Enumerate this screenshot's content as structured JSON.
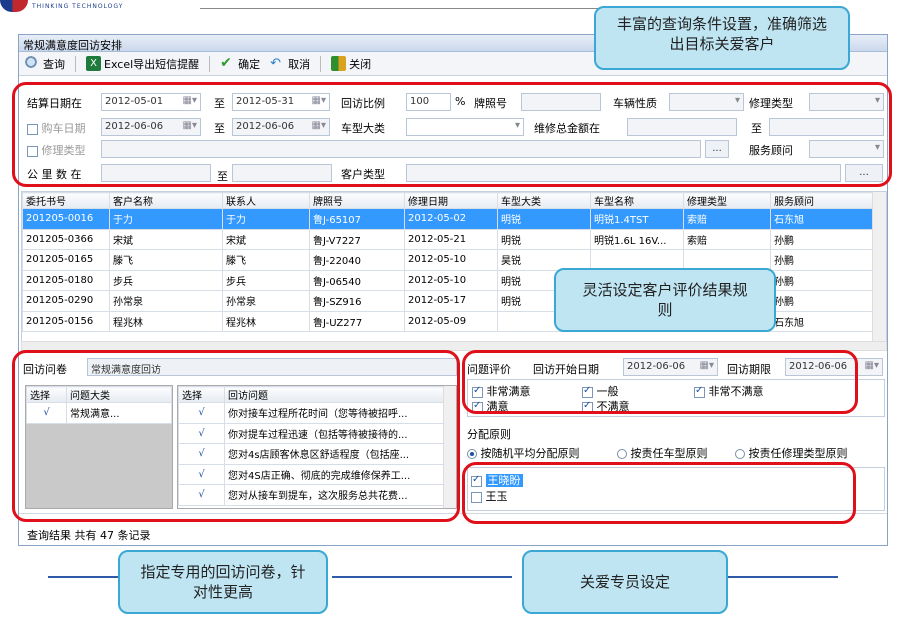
{
  "window": {
    "title": "常规满意度回访安排"
  },
  "toolbar": [
    {
      "label": "查询",
      "icon": "search-icon"
    },
    {
      "label": "Excel导出短信提醒",
      "icon": "excel-icon"
    },
    {
      "label": "确定",
      "icon": "check-icon"
    },
    {
      "label": "取消",
      "icon": "cancel-icon"
    },
    {
      "label": "关闭",
      "icon": "close-door-icon"
    }
  ],
  "filters": {
    "settle_date_label": "结算日期在",
    "settle_from": "2012-05-01",
    "to_label": "至",
    "settle_to": "2012-05-31",
    "visit_ratio_label": "回访比例",
    "visit_ratio": "100",
    "percent": "%",
    "plate_label": "牌照号",
    "vehicle_nature_label": "车辆性质",
    "repair_type_label": "修理类型",
    "purchase_date_label": "购车日期",
    "purchase_from": "2012-06-06",
    "purchase_to": "2012-06-06",
    "model_category_label": "车型大类",
    "repair_amount_label": "维修总金额在",
    "amount_to_label": "至",
    "repair_type2_label": "修理类型",
    "service_advisor_label": "服务顾问",
    "mileage_label": "公 里 数 在",
    "mileage_to_label": "至",
    "customer_type_label": "客户类型",
    "ellipsis": "..."
  },
  "table": {
    "columns": [
      "委托书号",
      "客户名称",
      "联系人",
      "牌照号",
      "修理日期",
      "车型大类",
      "车型名称",
      "修理类型",
      "服务顾问"
    ],
    "rows": [
      [
        "201205-0016",
        "于力",
        "于力",
        "鲁J-65107",
        "2012-05-02",
        "明锐",
        "明锐1.4TST",
        "索赔",
        "石东旭"
      ],
      [
        "201205-0366",
        "宋斌",
        "宋斌",
        "鲁J-V7227",
        "2012-05-21",
        "明锐",
        "明锐1.6L 16V...",
        "索赔",
        "孙鹏"
      ],
      [
        "201205-0165",
        "滕飞",
        "滕飞",
        "鲁J-22040",
        "2012-05-10",
        "昊锐",
        "",
        "",
        "孙鹏"
      ],
      [
        "201205-0180",
        "步兵",
        "步兵",
        "鲁J-06540",
        "2012-05-10",
        "明锐",
        "",
        "",
        "孙鹏"
      ],
      [
        "201205-0290",
        "孙常泉",
        "孙常泉",
        "鲁J-SZ916",
        "2012-05-17",
        "明锐",
        "",
        "",
        "孙鹏"
      ],
      [
        "201205-0156",
        "程兆林",
        "程兆林",
        "鲁J-UZ277",
        "2012-05-09",
        "",
        "",
        "",
        "石东旭"
      ]
    ]
  },
  "questionnaire": {
    "label": "回访问卷",
    "selected": "常规满意度回访",
    "left_columns": [
      "选择",
      "问题大类"
    ],
    "left_rows": [
      [
        "√",
        "常规满意..."
      ]
    ],
    "right_columns": [
      "选择",
      "回访问题"
    ],
    "right_rows": [
      [
        "√",
        "你对接车过程所花时间（您等待被招呼..."
      ],
      [
        "√",
        "你对提车过程迅速（包括等待被接待的..."
      ],
      [
        "√",
        "您对4s店顾客休息区舒适程度（包括座..."
      ],
      [
        "√",
        "您对4S店正确、彻底的完成维修保养工..."
      ],
      [
        "√",
        "您对从接车到提车，这次服务总共花费..."
      ]
    ]
  },
  "evaluation": {
    "label": "问题评价",
    "start_label": "回访开始日期",
    "start_date": "2012-06-06",
    "deadline_label": "回访期限",
    "deadline": "2012-06-06",
    "options": [
      {
        "label": "非常满意",
        "checked": true
      },
      {
        "label": "一般",
        "checked": true
      },
      {
        "label": "非常不满意",
        "checked": true
      },
      {
        "label": "满意",
        "checked": true
      },
      {
        "label": "不满意",
        "checked": true
      }
    ]
  },
  "allocation": {
    "label": "分配原则",
    "options": [
      {
        "label": "按随机平均分配原则",
        "selected": true
      },
      {
        "label": "按责任车型原则",
        "selected": false
      },
      {
        "label": "按责任修理类型原则",
        "selected": false
      }
    ]
  },
  "staff": [
    {
      "name": "王晓盼",
      "checked": true
    },
    {
      "name": "王玉",
      "checked": false
    }
  ],
  "status": "查询结果 共有 47 条记录",
  "callouts": {
    "top": "丰富的查询条件设置，准确筛选出目标关爱客户",
    "middle": "灵活设定客户评价结果规则",
    "bottom_left": "指定专用的回访问卷，针对性更高",
    "bottom_right": "关爱专员设定"
  },
  "colors": {
    "highlight": "#e0101a",
    "callout_bg": "#bfe5f3",
    "selection": "#3399ff"
  }
}
